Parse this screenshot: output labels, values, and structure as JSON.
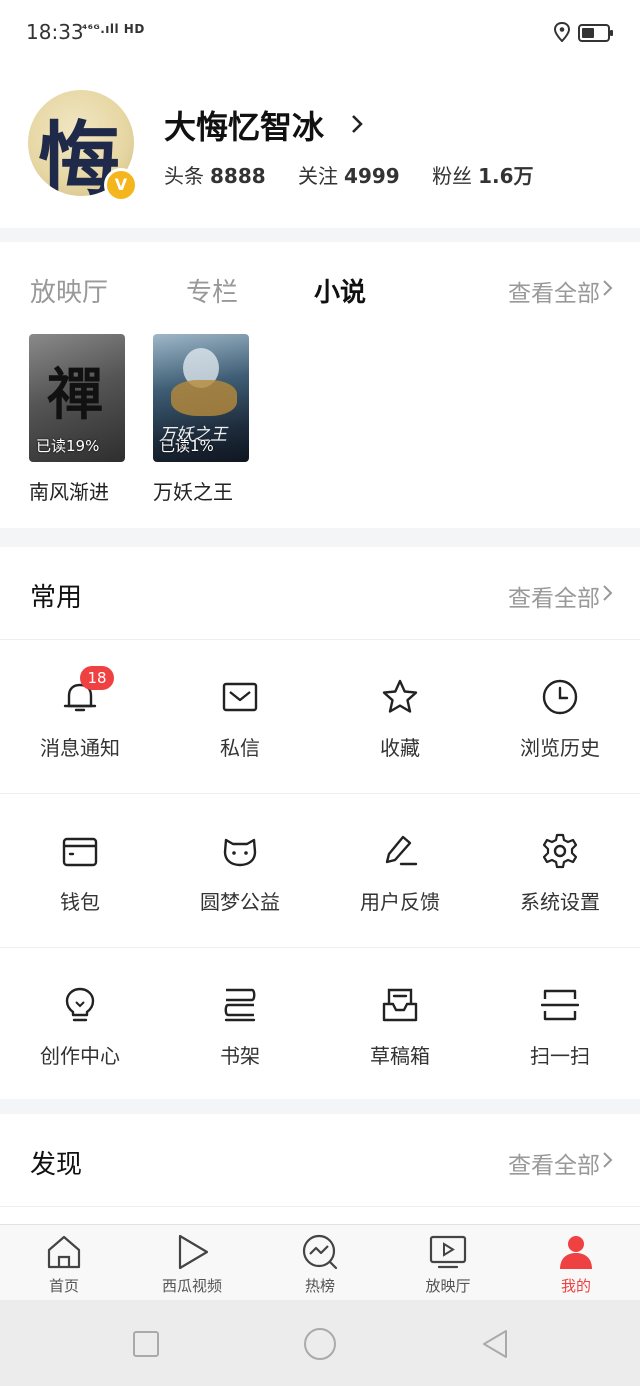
{
  "status": {
    "time": "18:33",
    "network": "⁴⁶ᴳ.ıll HD"
  },
  "profile": {
    "name": "大悔忆智冰",
    "avatar_glyph": "悔",
    "badge": "V",
    "stats": [
      {
        "label": "头条",
        "value": "8888"
      },
      {
        "label": "关注",
        "value": "4999"
      },
      {
        "label": "粉丝",
        "value": "1.6万"
      }
    ]
  },
  "content_tabs": {
    "tabs": [
      "放映厅",
      "专栏",
      "小说"
    ],
    "active": "小说",
    "view_all": "查看全部",
    "books": [
      {
        "title": "南风渐进",
        "progress": "已读19%",
        "cover_glyph": "禪"
      },
      {
        "title": "万妖之王",
        "progress": "已读1%",
        "cover_glyph": "万妖之王"
      }
    ]
  },
  "common": {
    "title": "常用",
    "view_all": "查看全部",
    "rows": [
      [
        {
          "label": "消息通知",
          "icon": "bell-icon",
          "badge": "18"
        },
        {
          "label": "私信",
          "icon": "mail-icon"
        },
        {
          "label": "收藏",
          "icon": "star-icon"
        },
        {
          "label": "浏览历史",
          "icon": "clock-icon"
        }
      ],
      [
        {
          "label": "钱包",
          "icon": "wallet-icon"
        },
        {
          "label": "圆梦公益",
          "icon": "cat-face-icon"
        },
        {
          "label": "用户反馈",
          "icon": "pen-icon"
        },
        {
          "label": "系统设置",
          "icon": "gear-icon"
        }
      ],
      [
        {
          "label": "创作中心",
          "icon": "lightbulb-icon"
        },
        {
          "label": "书架",
          "icon": "bookshelf-icon"
        },
        {
          "label": "草稿箱",
          "icon": "inbox-icon"
        },
        {
          "label": "扫一扫",
          "icon": "scan-icon"
        }
      ]
    ]
  },
  "discover": {
    "title": "发现",
    "view_all": "查看全部"
  },
  "tabbar": [
    {
      "label": "首页",
      "icon": "home-icon"
    },
    {
      "label": "西瓜视频",
      "icon": "play-icon"
    },
    {
      "label": "热榜",
      "icon": "trending-icon"
    },
    {
      "label": "放映厅",
      "icon": "tv-icon"
    },
    {
      "label": "我的",
      "icon": "person-icon",
      "active": true
    }
  ],
  "colors": {
    "accent": "#f04142",
    "badge": "#f5b51c"
  }
}
